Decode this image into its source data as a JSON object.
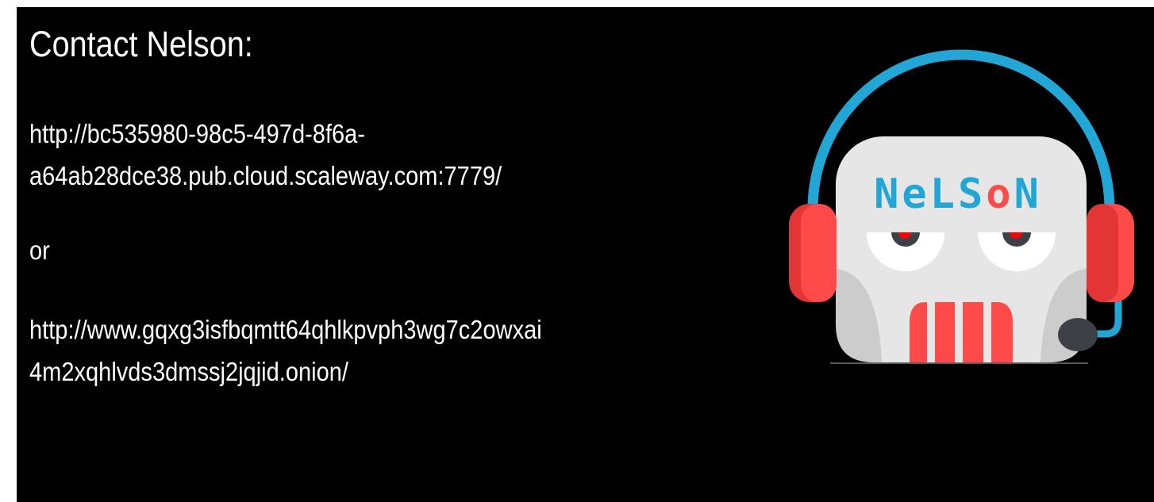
{
  "slide": {
    "title": "Contact Nelson:",
    "url1_line1": "http://bc535980-98c5-497d-8f6a-",
    "url1_line2": "a64ab28dce38.pub.cloud.scaleway.com:7779/",
    "separator": "or",
    "url2_line1": "http://www.gqxg3isfbqmtt64qhlkpvph3wg7c2owxai",
    "url2_line2": "4m2xqhlvds3dmssj2jqjid.onion/"
  },
  "logo": {
    "text": "NeLSoN",
    "icon": "robot-headset-logo",
    "colors": {
      "blue": "#22a6d6",
      "red": "#ff4a4a",
      "face": "#e6e6e6",
      "dark": "#3e4047"
    }
  }
}
